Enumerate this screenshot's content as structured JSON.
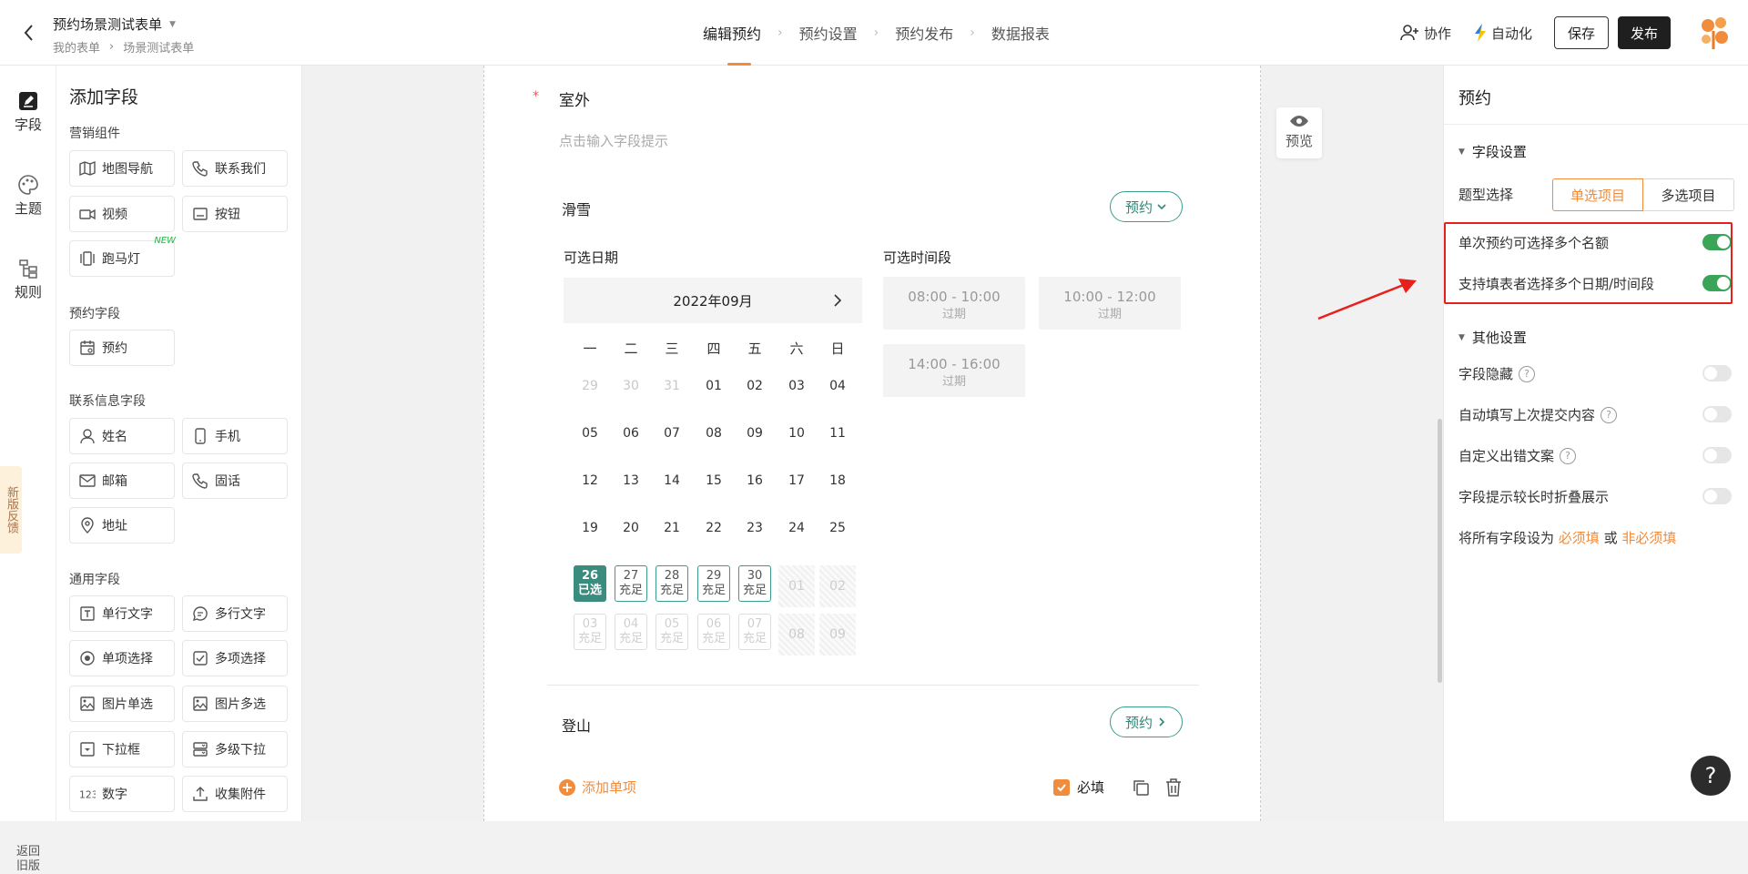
{
  "header": {
    "form_title": "预约场景测试表单",
    "breadcrumb": [
      "我的表单",
      "场景测试表单"
    ],
    "steps": [
      "编辑预约",
      "预约设置",
      "预约发布",
      "数据报表"
    ],
    "collab_label": "协作",
    "auto_label": "自动化",
    "save_label": "保存",
    "publish_label": "发布"
  },
  "rail": {
    "items": [
      "字段",
      "主题",
      "规则"
    ],
    "feedback": "新版反馈",
    "return_old": "返回旧版"
  },
  "fields_panel": {
    "title": "添加字段",
    "groups": [
      {
        "name": "营销组件",
        "items": [
          "地图导航",
          "联系我们",
          "视频",
          "按钮",
          "跑马灯"
        ]
      },
      {
        "name": "预约字段",
        "items": [
          "预约"
        ]
      },
      {
        "name": "联系信息字段",
        "items": [
          "姓名",
          "手机",
          "邮箱",
          "固话",
          "地址"
        ]
      },
      {
        "name": "通用字段",
        "items": [
          "单行文字",
          "多行文字",
          "单项选择",
          "多项选择",
          "图片单选",
          "图片多选",
          "下拉框",
          "多级下拉",
          "数字",
          "收集附件"
        ]
      }
    ],
    "new_tag": "NEW"
  },
  "form": {
    "question_title": "室外",
    "question_hint": "点击输入字段提示",
    "option1_title": "滑雪",
    "option2_title": "登山",
    "appointment_label": "预约",
    "date_label": "可选日期",
    "time_label": "可选时间段",
    "calendar_month": "2022年09月",
    "weekdays": [
      "一",
      "二",
      "三",
      "四",
      "五",
      "六",
      "日"
    ],
    "calendar_rows": [
      [
        {
          "d": "29",
          "s": "muted"
        },
        {
          "d": "30",
          "s": "muted"
        },
        {
          "d": "31",
          "s": "muted"
        },
        {
          "d": "01"
        },
        {
          "d": "02"
        },
        {
          "d": "03"
        },
        {
          "d": "04"
        }
      ],
      [
        {
          "d": "05"
        },
        {
          "d": "06"
        },
        {
          "d": "07"
        },
        {
          "d": "08"
        },
        {
          "d": "09"
        },
        {
          "d": "10"
        },
        {
          "d": "11"
        }
      ],
      [
        {
          "d": "12"
        },
        {
          "d": "13"
        },
        {
          "d": "14"
        },
        {
          "d": "15"
        },
        {
          "d": "16"
        },
        {
          "d": "17"
        },
        {
          "d": "18"
        }
      ],
      [
        {
          "d": "19"
        },
        {
          "d": "20"
        },
        {
          "d": "21"
        },
        {
          "d": "22"
        },
        {
          "d": "23"
        },
        {
          "d": "24"
        },
        {
          "d": "25"
        }
      ],
      [
        {
          "d": "26",
          "n": "已选",
          "s": "sel"
        },
        {
          "d": "27",
          "n": "充足",
          "s": "box"
        },
        {
          "d": "28",
          "n": "充足",
          "s": "box"
        },
        {
          "d": "29",
          "n": "充足",
          "s": "box"
        },
        {
          "d": "30",
          "n": "充足",
          "s": "box"
        },
        {
          "d": "01",
          "s": "hatch"
        },
        {
          "d": "02",
          "s": "hatch"
        }
      ],
      [
        {
          "d": "03",
          "n": "充足",
          "s": "boxdim"
        },
        {
          "d": "04",
          "n": "充足",
          "s": "boxdim"
        },
        {
          "d": "05",
          "n": "充足",
          "s": "boxdim"
        },
        {
          "d": "06",
          "n": "充足",
          "s": "boxdim"
        },
        {
          "d": "07",
          "n": "充足",
          "s": "boxdim"
        },
        {
          "d": "08",
          "s": "hatch"
        },
        {
          "d": "09",
          "s": "hatch"
        }
      ]
    ],
    "time_slots": [
      {
        "time": "08:00 - 10:00",
        "status": "过期"
      },
      {
        "time": "10:00 - 12:00",
        "status": "过期"
      },
      {
        "time": "14:00 - 16:00",
        "status": "过期"
      }
    ],
    "add_option_label": "添加单项",
    "required_label": "必填",
    "preview_label": "预览"
  },
  "settings": {
    "title": "预约",
    "field_settings": "字段设置",
    "type_label": "题型选择",
    "type_options": [
      "单选项目",
      "多选项目"
    ],
    "toggle1_label": "单次预约可选择多个名额",
    "toggle2_label": "支持填表者选择多个日期/时间段",
    "other_settings": "其他设置",
    "other_items": [
      "字段隐藏",
      "自动填写上次提交内容",
      "自定义出错文案",
      "字段提示较长时折叠展示"
    ],
    "toggle1_on": true,
    "toggle2_on": true,
    "must_prefix": "将所有字段设为",
    "must_required": "必须填",
    "must_or": "或",
    "must_optional": "非必须填",
    "help_label": "?"
  },
  "colors": {
    "accent": "#f08c3c",
    "teal": "#3a9c8c",
    "toggle_on": "#3aa557",
    "highlight": "#e8201c"
  }
}
